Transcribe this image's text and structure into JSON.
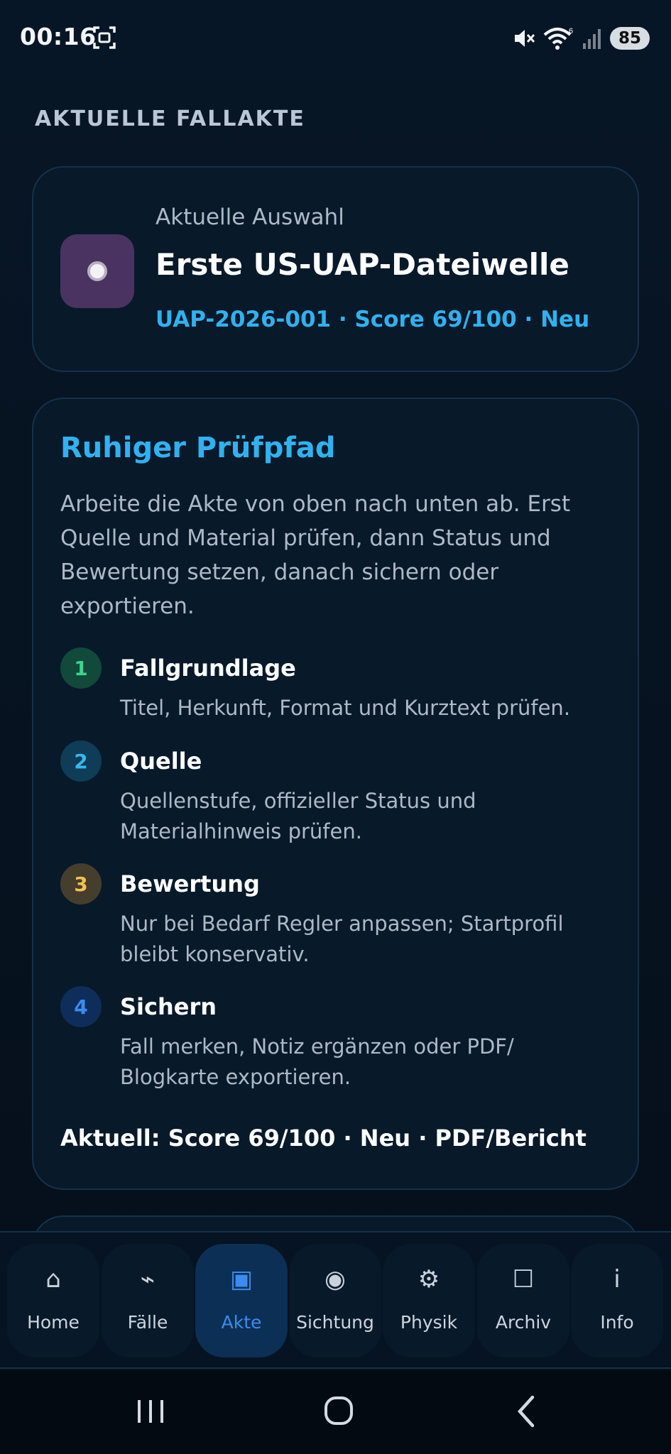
{
  "status_bar": {
    "time": "00:16",
    "battery": "85",
    "icons": [
      "screenshot-icon",
      "mute-icon",
      "wifi-icon",
      "signal-icon"
    ]
  },
  "section_heading": "AKTUELLE FALLAKTE",
  "selection": {
    "eyebrow": "Aktuelle Auswahl",
    "title": "Erste US-UAP-Dateiwelle",
    "meta": "UAP-2026-001 · Score 69/100 · Neu",
    "avatar_color": "#4a3360"
  },
  "path": {
    "title": "Ruhiger Prüfpfad",
    "description": "Arbeite die Akte von oben nach unten ab. Erst Quelle und Material prüfen, dann Status und Bewertung setzen, danach sichern oder exportieren.",
    "steps": [
      {
        "number": "1",
        "title": "Fallgrundlage",
        "description": "Titel, Herkunft, Format und Kurztext prüfen.",
        "color": "#3fd28f"
      },
      {
        "number": "2",
        "title": "Quelle",
        "description": "Quellenstufe, offizieller Status und Materialhinweis prüfen.",
        "color": "#39b6ef"
      },
      {
        "number": "3",
        "title": "Bewertung",
        "description": "Nur bei Bedarf Regler anpassen; Startprofil bleibt konservativ.",
        "color": "#f0c253"
      },
      {
        "number": "4",
        "title": "Sichern",
        "description": "Fall merken, Notiz ergänzen oder PDF/ Blogkarte exportieren.",
        "color": "#3a8cf0"
      }
    ],
    "current": "Aktuell: Score 69/100 · Neu · PDF/Bericht"
  },
  "nav": {
    "active": "Akte",
    "items": [
      {
        "label": "Home",
        "icon": "⌂",
        "icon_name": "home-icon"
      },
      {
        "label": "Fälle",
        "icon": "⌁",
        "icon_name": "lightning-icon"
      },
      {
        "label": "Akte",
        "icon": "▣",
        "icon_name": "file-icon"
      },
      {
        "label": "Sichtung",
        "icon": "◉",
        "icon_name": "sighting-icon"
      },
      {
        "label": "Physik",
        "icon": "⚙",
        "icon_name": "physics-icon"
      },
      {
        "label": "Archiv",
        "icon": "☐",
        "icon_name": "archive-icon"
      },
      {
        "label": "Info",
        "icon": "i",
        "icon_name": "info-icon"
      }
    ]
  },
  "accent_color": "#2fb2ef"
}
